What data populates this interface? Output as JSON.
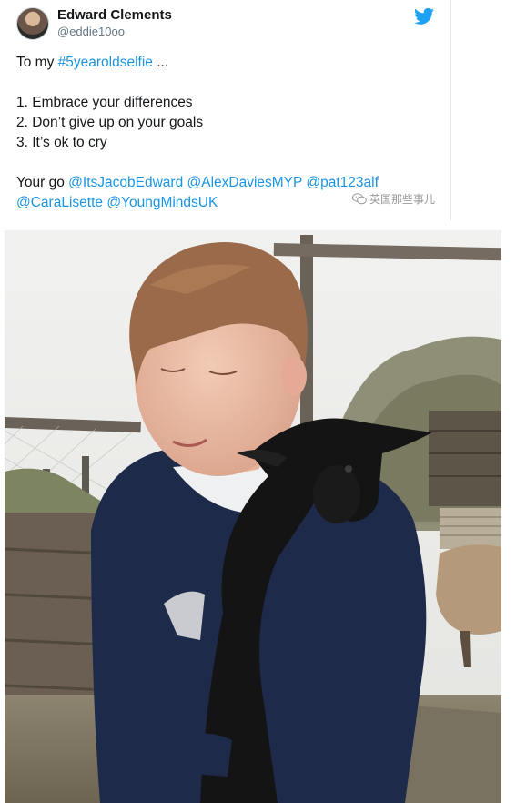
{
  "tweet": {
    "author_name": "Edward Clements",
    "author_handle": "@eddie10oo",
    "intro_prefix": "To my ",
    "intro_hashtag": "#5yearoldselfie",
    "intro_suffix": " ...",
    "list": [
      "1. Embrace your differences",
      "2. Don’t give up on your goals",
      "3. It’s ok to cry"
    ],
    "outro_prefix": "Your go ",
    "mentions_line1": [
      "@ItsJacobEdward",
      "@AlexDaviesMYP",
      "@pat123alf"
    ],
    "mentions_line2": [
      "@CaraLisette",
      "@YoungMindsUK"
    ]
  },
  "watermark": {
    "text": "英国那些事儿",
    "icon": "wechat-icon"
  },
  "photo": {
    "icon": "boy-holding-black-goat-photo"
  },
  "colors": {
    "link": "#1b95e0",
    "twitter_blue": "#1da1f2"
  }
}
